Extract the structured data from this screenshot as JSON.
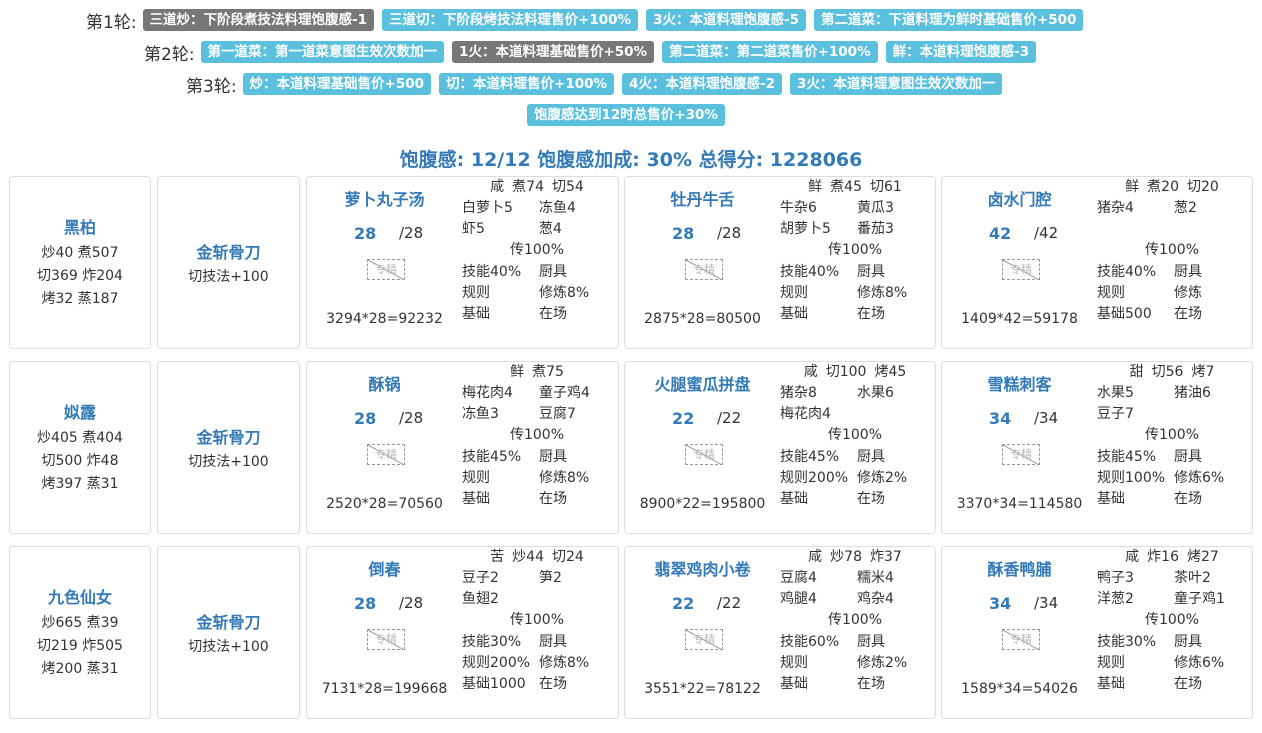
{
  "rounds": [
    {
      "label": "第1轮:",
      "tags": [
        {
          "text": "三道炒：下阶段煮技法料理饱腹感-1",
          "style": "gray"
        },
        {
          "text": "三道切：下阶段烤技法料理售价+100%",
          "style": "blue"
        },
        {
          "text": "3火：本道料理饱腹感-5",
          "style": "blue"
        },
        {
          "text": "第二道菜：下道料理为鲜时基础售价+500",
          "style": "blue"
        }
      ]
    },
    {
      "label": "第2轮:",
      "tags": [
        {
          "text": "第一道菜：第一道菜意图生效次数加一",
          "style": "blue"
        },
        {
          "text": "1火：本道料理基础售价+50%",
          "style": "gray"
        },
        {
          "text": "第二道菜：第二道菜售价+100%",
          "style": "blue"
        },
        {
          "text": "鲜：本道料理饱腹感-3",
          "style": "blue"
        }
      ]
    },
    {
      "label": "第3轮:",
      "tags": [
        {
          "text": "炒：本道料理基础售价+500",
          "style": "blue"
        },
        {
          "text": "切：本道料理售价+100%",
          "style": "blue"
        },
        {
          "text": "4火：本道料理饱腹感-2",
          "style": "blue"
        },
        {
          "text": "3火：本道料理意图生效次数加一",
          "style": "blue"
        }
      ]
    },
    {
      "label": "",
      "tags": [
        {
          "text": "饱腹感达到12时总售价+30%",
          "style": "blue"
        }
      ]
    }
  ],
  "summary": "饱腹感: 12/12 饱腹感加成: 30% 总得分: 1228066",
  "image_placeholder": "专精",
  "rows": [
    {
      "chef": {
        "name": "黑柏",
        "lines": [
          "炒40 煮507",
          "切369 炸204",
          "烤32 蒸187"
        ]
      },
      "tool": {
        "name": "金斩骨刀",
        "desc": "切技法+100"
      },
      "dishes": [
        {
          "name": "萝卜丸子汤",
          "count": "28",
          "total": "/28",
          "calc": "3294*28=92232",
          "flavors": [
            "咸",
            "煮74",
            "切54"
          ],
          "ingredients": [
            "白萝卜5",
            "冻鱼4",
            "虾5",
            "葱4"
          ],
          "chuan": "传100%",
          "stats": [
            "技能40%",
            "厨具",
            "规则",
            "修炼8%",
            "基础",
            "在场"
          ]
        },
        {
          "name": "牡丹牛舌",
          "count": "28",
          "total": "/28",
          "calc": "2875*28=80500",
          "flavors": [
            "鲜",
            "煮45",
            "切61"
          ],
          "ingredients": [
            "牛杂6",
            "黄瓜3",
            "胡萝卜5",
            "番茄3"
          ],
          "chuan": "传100%",
          "stats": [
            "技能40%",
            "厨具",
            "规则",
            "修炼8%",
            "基础",
            "在场"
          ]
        },
        {
          "name": "卤水门腔",
          "count": "42",
          "total": "/42",
          "calc": "1409*42=59178",
          "flavors": [
            "鲜",
            "煮20",
            "切20"
          ],
          "ingredients": [
            "猪杂4",
            "葱2",
            "",
            ""
          ],
          "chuan": "传100%",
          "stats": [
            "技能40%",
            "厨具",
            "规则",
            "修炼",
            "基础500",
            "在场"
          ]
        }
      ]
    },
    {
      "chef": {
        "name": "姒露",
        "lines": [
          "炒405 煮404",
          "切500 炸48",
          "烤397 蒸31"
        ]
      },
      "tool": {
        "name": "金斩骨刀",
        "desc": "切技法+100"
      },
      "dishes": [
        {
          "name": "酥锅",
          "count": "28",
          "total": "/28",
          "calc": "2520*28=70560",
          "flavors": [
            "鲜",
            "煮75"
          ],
          "ingredients": [
            "梅花肉4",
            "童子鸡4",
            "冻鱼3",
            "豆腐7"
          ],
          "chuan": "传100%",
          "stats": [
            "技能45%",
            "厨具",
            "规则",
            "修炼8%",
            "基础",
            "在场"
          ]
        },
        {
          "name": "火腿蜜瓜拼盘",
          "count": "22",
          "total": "/22",
          "calc": "8900*22=195800",
          "flavors": [
            "咸",
            "切100",
            "烤45"
          ],
          "ingredients": [
            "猪杂8",
            "水果6",
            "梅花肉4",
            ""
          ],
          "chuan": "传100%",
          "stats": [
            "技能45%",
            "厨具",
            "规则200%",
            "修炼2%",
            "基础",
            "在场"
          ]
        },
        {
          "name": "雪糕刺客",
          "count": "34",
          "total": "/34",
          "calc": "3370*34=114580",
          "flavors": [
            "甜",
            "切56",
            "烤7"
          ],
          "ingredients": [
            "水果5",
            "猪油6",
            "豆子7",
            ""
          ],
          "chuan": "传100%",
          "stats": [
            "技能45%",
            "厨具",
            "规则100%",
            "修炼6%",
            "基础",
            "在场"
          ]
        }
      ]
    },
    {
      "chef": {
        "name": "九色仙女",
        "lines": [
          "炒665 煮39",
          "切219 炸505",
          "烤200 蒸31"
        ]
      },
      "tool": {
        "name": "金斩骨刀",
        "desc": "切技法+100"
      },
      "dishes": [
        {
          "name": "倒春",
          "count": "28",
          "total": "/28",
          "calc": "7131*28=199668",
          "flavors": [
            "苦",
            "炒44",
            "切24"
          ],
          "ingredients": [
            "豆子2",
            "笋2",
            "鱼翅2",
            ""
          ],
          "chuan": "传100%",
          "stats": [
            "技能30%",
            "厨具",
            "规则200%",
            "修炼8%",
            "基础1000",
            "在场"
          ]
        },
        {
          "name": "翡翠鸡肉小卷",
          "count": "22",
          "total": "/22",
          "calc": "3551*22=78122",
          "flavors": [
            "咸",
            "炒78",
            "炸37"
          ],
          "ingredients": [
            "豆腐4",
            "糯米4",
            "鸡腿4",
            "鸡杂4"
          ],
          "chuan": "传100%",
          "stats": [
            "技能60%",
            "厨具",
            "规则",
            "修炼2%",
            "基础",
            "在场"
          ]
        },
        {
          "name": "酥香鸭脯",
          "count": "34",
          "total": "/34",
          "calc": "1589*34=54026",
          "flavors": [
            "咸",
            "炸16",
            "烤27"
          ],
          "ingredients": [
            "鸭子3",
            "茶叶2",
            "洋葱2",
            "童子鸡1"
          ],
          "chuan": "传100%",
          "stats": [
            "技能30%",
            "厨具",
            "规则",
            "修炼6%",
            "基础",
            "在场"
          ]
        }
      ]
    }
  ]
}
